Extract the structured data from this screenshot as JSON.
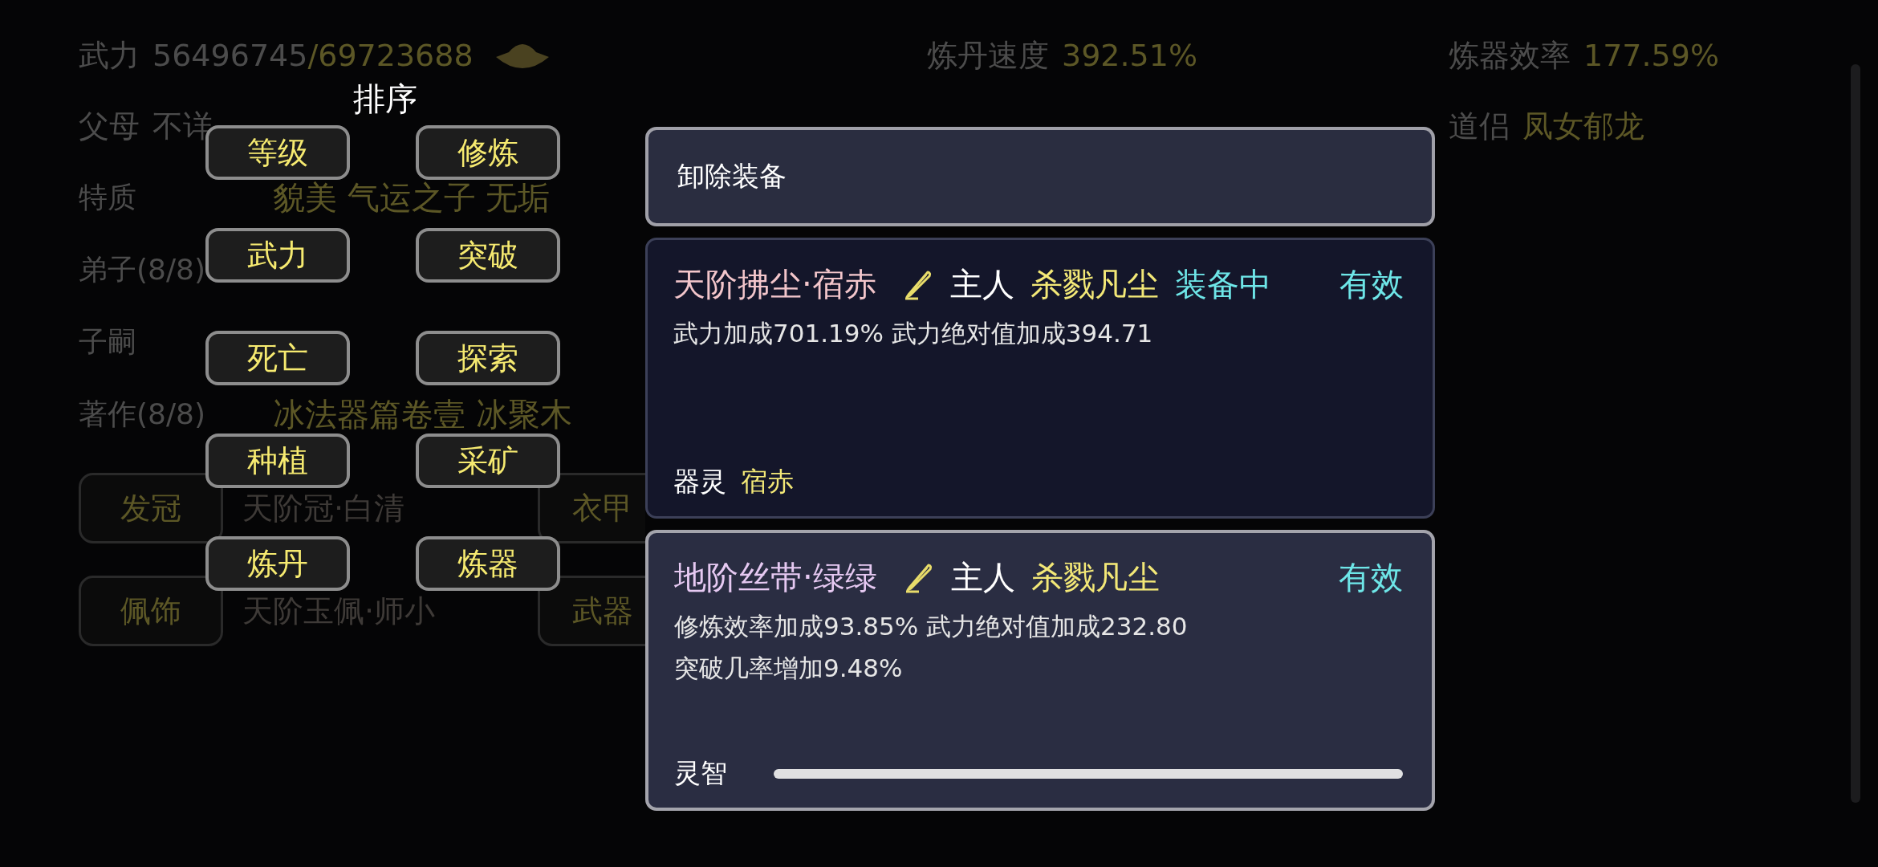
{
  "top_info": {
    "power": {
      "label": "武力",
      "value": "56496745",
      "limit": "/69723688"
    },
    "alchemy_speed": {
      "label": "炼丹速度",
      "value": "392.51%"
    },
    "forging_rate": {
      "label": "炼器效率",
      "value": "177.59%"
    },
    "parents": {
      "label": "父母",
      "value": "不详"
    },
    "partner": {
      "label": "道侣",
      "value": "凤女郁龙"
    }
  },
  "details": [
    {
      "label": "特质",
      "value": "貌美 气运之子 无垢"
    },
    {
      "label": "弟子(8/8)"
    },
    {
      "label": "子嗣"
    },
    {
      "label": "著作(8/8)",
      "value": "冰法器篇卷壹 冰聚木"
    }
  ],
  "equipment_slots": [
    [
      {
        "slot": "发冠",
        "item": "天阶冠·白清"
      },
      {
        "slot": "衣甲"
      }
    ],
    [
      {
        "slot": "佩饰",
        "item": "天阶玉佩·师小"
      },
      {
        "slot": "武器"
      }
    ]
  ],
  "sort_menu": {
    "title": "排序",
    "options": [
      "等级",
      "修炼",
      "武力",
      "突破",
      "死亡",
      "探索",
      "种植",
      "采矿",
      "炼丹",
      "炼器"
    ]
  },
  "equip_panel": {
    "unequip_button": "卸除装备",
    "items": [
      {
        "name": "天阶拂尘·宿赤",
        "color": "#f3c6cb",
        "owner_label": "主人",
        "owner": "杀戮凡尘",
        "status": "装备中",
        "validity": "有效",
        "effects": [
          "武力加成701.19% 武力绝对值加成394.71"
        ],
        "spirit_label": "器灵",
        "spirit": "宿赤",
        "selected": false
      },
      {
        "name": "地阶丝带·绿绿",
        "color": "#e6c9f2",
        "owner_label": "主人",
        "owner": "杀戮凡尘",
        "validity": "有效",
        "effects": [
          "修炼效率加成93.85% 武力绝对值加成232.80",
          "突破几率增加9.48%"
        ],
        "intelligence_label": "灵智",
        "selected": true
      }
    ]
  }
}
